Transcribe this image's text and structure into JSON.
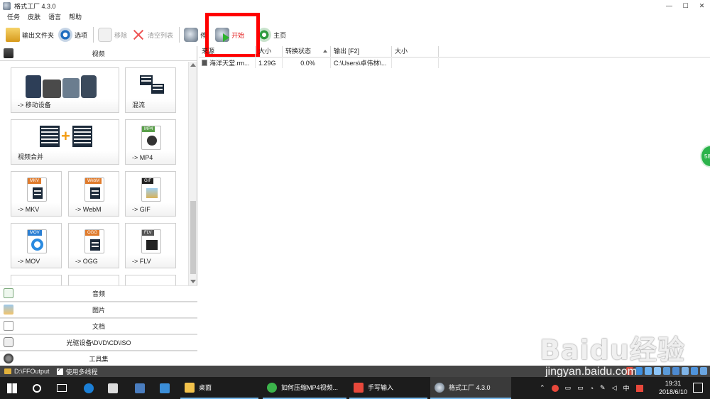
{
  "window": {
    "title": "格式工厂 4.3.0",
    "buttons": [
      "—",
      "☐",
      "✕"
    ]
  },
  "menu": [
    "任务",
    "皮肤",
    "语言",
    "帮助"
  ],
  "toolbar": {
    "output_folder": "输出文件夹",
    "options": "选项",
    "remove": "移除",
    "clear_list": "清空列表",
    "stop": "停",
    "start": "开始",
    "home": "主页"
  },
  "left": {
    "video_category": "视频",
    "tiles": [
      {
        "label": "-> 移动设备"
      },
      {
        "label": "混流"
      },
      {
        "label": "视频合并"
      },
      {
        "label": "-> MP4",
        "badge": "MP4"
      },
      {
        "label": "-> MKV",
        "badge": "MKV"
      },
      {
        "label": "-> WebM",
        "badge": "WebM"
      },
      {
        "label": "-> GIF",
        "badge": "GIF"
      },
      {
        "label": "-> MOV",
        "badge": "MOV"
      },
      {
        "label": "-> OGG",
        "badge": "OGG"
      },
      {
        "label": "-> FLV",
        "badge": "FLV"
      }
    ],
    "categories": [
      "音频",
      "图片",
      "文档",
      "光驱设备\\DVD\\CD\\ISO",
      "工具集"
    ]
  },
  "list": {
    "columns": [
      "来源",
      "大小",
      "转换状态",
      "输出 [F2]",
      "大小"
    ],
    "rows": [
      {
        "source": "海洋天堂.rm...",
        "size": "1.29G",
        "status": "0.0%",
        "output": "C:\\Users\\卓伟林\\...",
        "out_size": ""
      }
    ]
  },
  "side_badge": "58",
  "status": {
    "output_path": "D:\\FFOutput",
    "multithread": "使用多线程"
  },
  "watermark": {
    "main": "Baidu经验",
    "sub": "jingyan.baidu.com"
  },
  "taskbar": {
    "items": [
      "桌面",
      "如何压缩MP4视频...",
      "手写输入",
      "格式工厂 4.3.0"
    ],
    "ime": "中",
    "time": "19:31",
    "date": "2018/6/10"
  }
}
